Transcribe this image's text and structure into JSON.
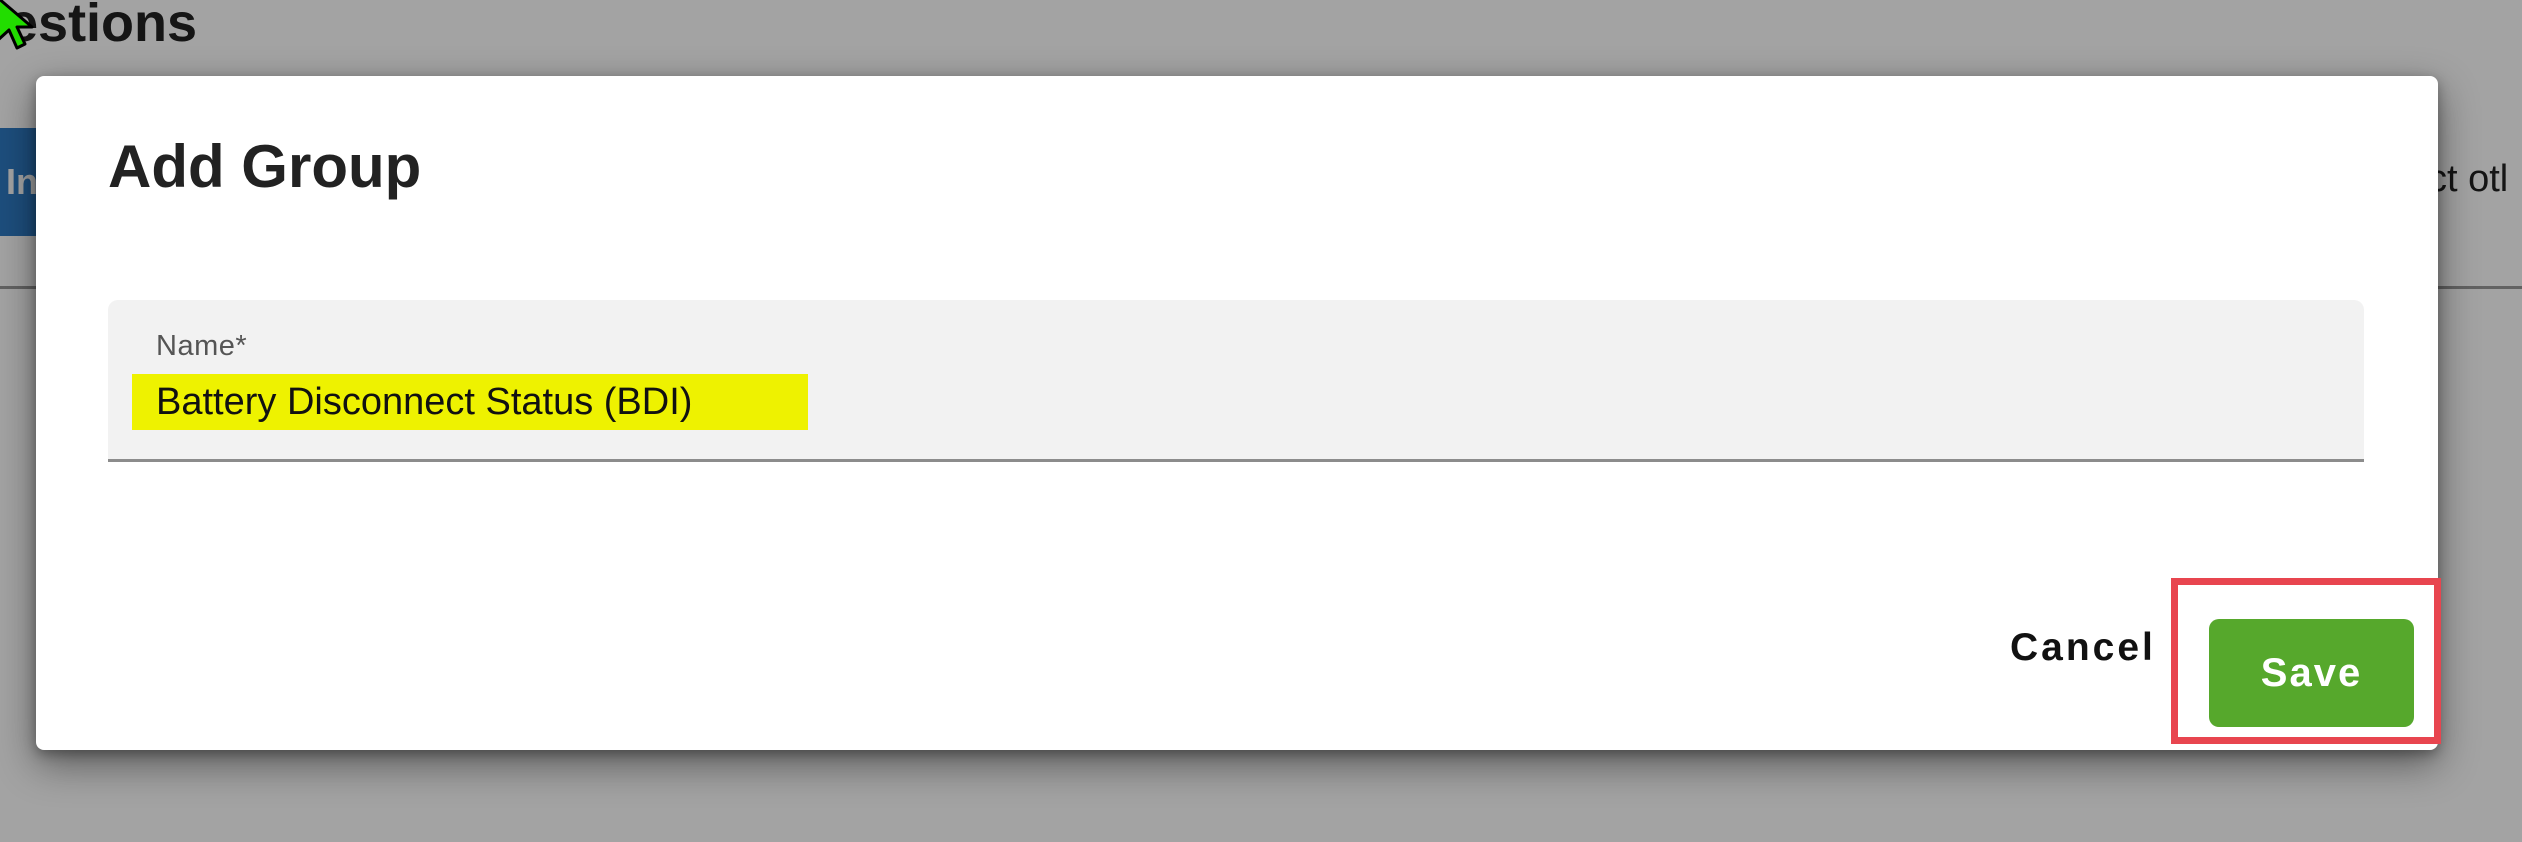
{
  "background": {
    "page_title": "estions",
    "left_button_label": "In",
    "right_text": "ct otl"
  },
  "dialog": {
    "title": "Add Group",
    "name_field": {
      "label": "Name*",
      "value": "Battery Disconnect Status (BDI)"
    },
    "cancel_label": "Cancel",
    "save_label": "Save"
  },
  "colors": {
    "save_button": "#56a82c",
    "highlight_text_bg": "#eef200",
    "highlight_outline": "#e8454f",
    "cursor": "#22dd00"
  },
  "icons": {
    "cursor": "mouse-pointer-icon"
  }
}
